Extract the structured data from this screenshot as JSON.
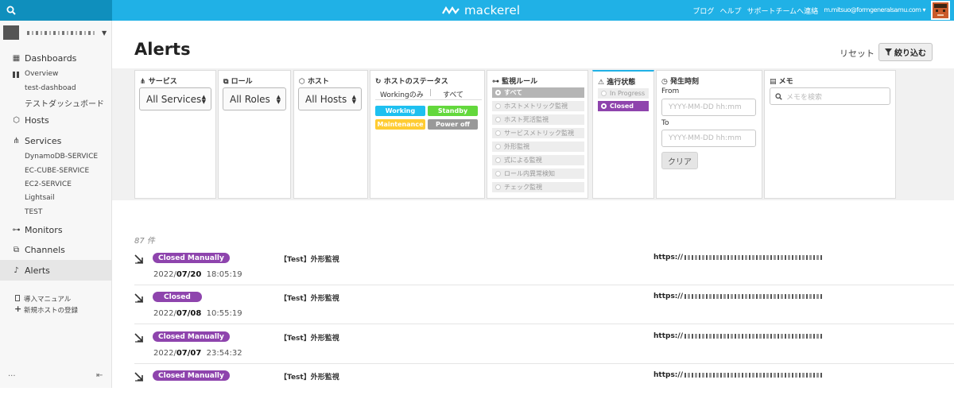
{
  "app": {
    "brand": "mackerel",
    "brand_color": "#20b1e6"
  },
  "topnav": {
    "blog": "ブログ",
    "help": "ヘルプ",
    "support": "サポートチームへ連絡",
    "user": "m.mitsuo@formgeneralsamu.com ▾"
  },
  "search": {
    "icon": "search-icon"
  },
  "sidebar": {
    "main": [
      {
        "label": "Dashboards",
        "icon": "dashboard-icon",
        "glyph": "▦"
      },
      {
        "label": "Hosts",
        "icon": "cube-icon",
        "glyph": "⬡"
      },
      {
        "label": "Services",
        "icon": "services-icon",
        "glyph": "⋔"
      },
      {
        "label": "Monitors",
        "icon": "binoculars-icon",
        "glyph": "⊶"
      },
      {
        "label": "Channels",
        "icon": "channels-icon",
        "glyph": "⧉"
      },
      {
        "label": "Alerts",
        "icon": "bell-icon",
        "glyph": "♪"
      }
    ],
    "dashboards": [
      "Overview",
      "test-dashboad",
      "テストダッシュボード"
    ],
    "services": [
      "DynamoDB-SERVICE",
      "EC-CUBE-SERVICE",
      "EC2-SERVICE",
      "Lightsail",
      "TEST"
    ],
    "footer_links": [
      "導入マニュアル",
      "新規ホストの登録"
    ],
    "more": "···",
    "collapse": "⇤"
  },
  "page": {
    "title": "Alerts",
    "reset": "リセット",
    "filter": "絞り込む"
  },
  "filters": {
    "service": {
      "title": "サービス",
      "value": "All Services"
    },
    "role": {
      "title": "ロール",
      "value": "All Roles"
    },
    "host": {
      "title": "ホスト",
      "value": "All Hosts"
    },
    "host_status": {
      "title": "ホストのステータス",
      "tabs": [
        "Workingのみ",
        "すべて"
      ],
      "statuses": [
        {
          "label": "Working",
          "color": "#1ec0f0"
        },
        {
          "label": "Standby",
          "color": "#63d83c"
        },
        {
          "label": "Maintenance",
          "color": "#ffcc33"
        },
        {
          "label": "Power off",
          "color": "#999999"
        }
      ]
    },
    "monitor_rule": {
      "title": "監視ルール",
      "items": [
        "すべて",
        "ホストメトリック監視",
        "ホスト死活監視",
        "サービスメトリック監視",
        "外形監視",
        "式による監視",
        "ロール内異常検知",
        "チェック監視"
      ]
    },
    "progress": {
      "title": "進行状態",
      "items": [
        "In Progress",
        "Closed"
      ]
    },
    "time": {
      "title": "発生時刻",
      "from_label": "From",
      "to_label": "To",
      "placeholder": "YYYY-MM-DD hh:mm",
      "clear": "クリア"
    },
    "memo": {
      "title": "メモ",
      "placeholder": "メモを検索"
    }
  },
  "alerts": {
    "count": "87 件",
    "rows": [
      {
        "status": "Closed Manually",
        "title": "【Test】外形監視",
        "url": "https://",
        "date_pre": "2022/",
        "date_md": "07/20",
        "time": "18:05:19"
      },
      {
        "status": "Closed",
        "title": "【Test】外形監視",
        "url": "https://",
        "date_pre": "2022/",
        "date_md": "07/08",
        "time": "10:55:19"
      },
      {
        "status": "Closed Manually",
        "title": "【Test】外形監視",
        "url": "https://",
        "date_pre": "2022/",
        "date_md": "07/07",
        "time": "23:54:32"
      },
      {
        "status": "Closed Manually",
        "title": "【Test】外形監視",
        "url": "https://",
        "date_pre": "",
        "date_md": "",
        "time": ""
      }
    ]
  }
}
